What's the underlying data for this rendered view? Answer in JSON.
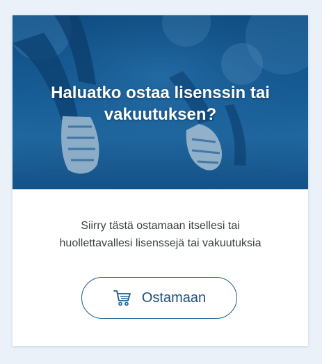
{
  "card": {
    "title": "Haluatko ostaa lisenssin tai vakuutuksen?",
    "description_lines": [
      "Siirry tästä ostamaan itsellesi tai",
      "huollettavallesi lisenssejä tai vakuutuksia"
    ],
    "button": {
      "label": "Ostamaan",
      "icon": "shopping-cart-icon"
    },
    "hero_image": "runners-starting-position-photo"
  },
  "colors": {
    "page_background": "#eaf1f8",
    "hero_overlay": "#1c6aa8",
    "button_border": "#1d5a8e",
    "button_text": "#1d4f7c",
    "body_text": "#3b3f44"
  }
}
